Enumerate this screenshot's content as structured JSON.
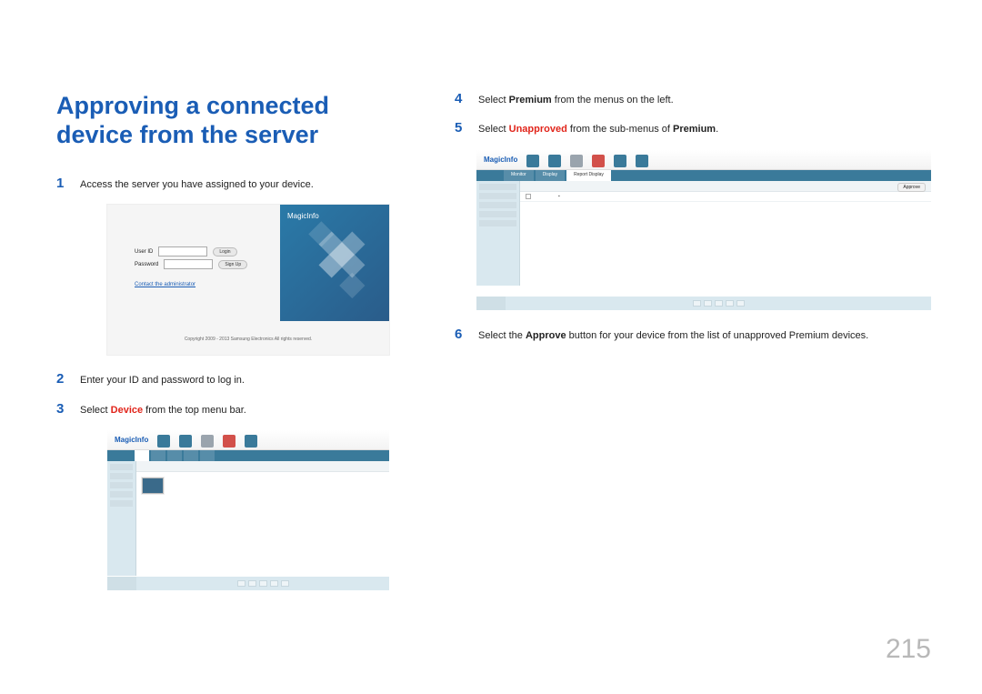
{
  "title": "Approving a connected device from the server",
  "page_number": "215",
  "steps": {
    "s1": {
      "text": "Access the server you have assigned to your device."
    },
    "s2": {
      "text": "Enter your ID and password to log in."
    },
    "s3": {
      "pre": "Select ",
      "hl": "Device",
      "post": " from the top menu bar."
    },
    "s4": {
      "pre": "Select ",
      "hl": "Premium",
      "post": " from the menus on the left."
    },
    "s5": {
      "pre": "Select ",
      "hl": "Unapproved",
      "mid": " from the sub-menus of ",
      "hl2": "Premium",
      "post": "."
    },
    "s6": {
      "pre": "Select the ",
      "hl": "Approve",
      "post": " button for your device from the list of unapproved Premium devices."
    }
  },
  "login": {
    "user_label": "User ID",
    "pass_label": "Password",
    "login_btn": "Login",
    "signup_btn": "Sign Up",
    "contact": "Contact the administrator",
    "copyright": "Copyright 2009 - 2013 Samsung Electronics All rights reserved.",
    "brand": "MagicInfo"
  },
  "app": {
    "brand": "MagicInfo",
    "approve_label": "Approve"
  }
}
